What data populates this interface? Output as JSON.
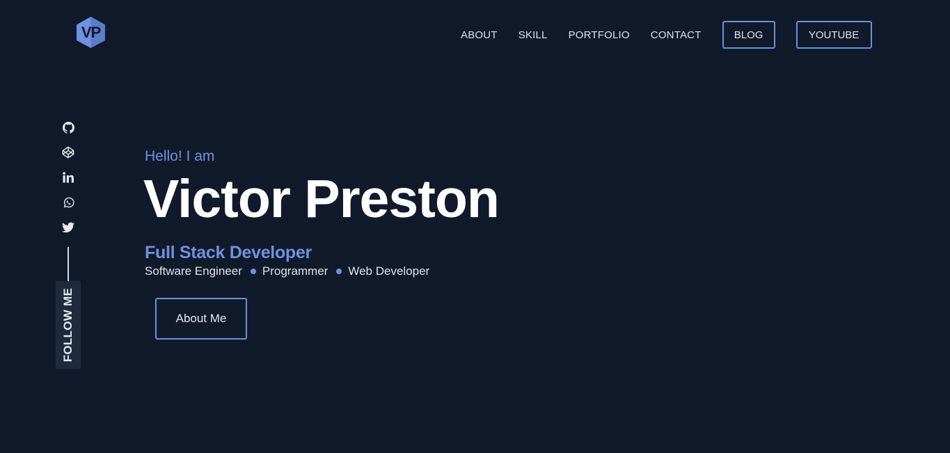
{
  "brand": {
    "logo_text": "VP",
    "accent_color": "#6f91e0"
  },
  "nav": {
    "links": [
      "ABOUT",
      "SKILL",
      "PORTFOLIO",
      "CONTACT"
    ],
    "blog_label": "BLOG",
    "youtube_label": "YOUTUBE"
  },
  "social": {
    "icons": [
      "github-icon",
      "codepen-icon",
      "linkedin-icon",
      "whatsapp-icon",
      "twitter-icon"
    ],
    "follow_label": "FOLLOW ME"
  },
  "hero": {
    "greeting": "Hello! I am",
    "name": "Victor Preston",
    "role": "Full Stack Developer",
    "skills": [
      "Software Engineer",
      "Programmer",
      "Web Developer"
    ],
    "cta_label": "About Me"
  }
}
